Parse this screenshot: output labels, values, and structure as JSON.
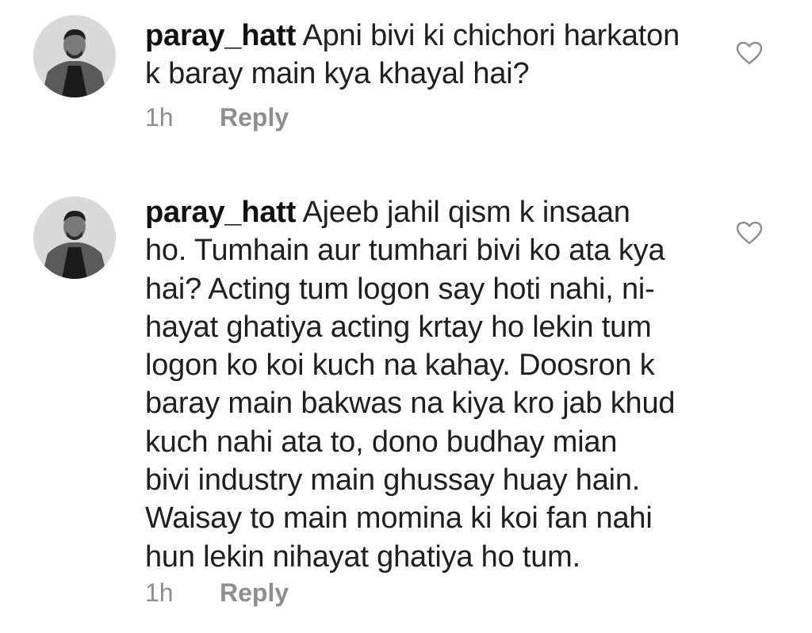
{
  "comments": [
    {
      "username": "paray_hatt",
      "lines": [
        "Apni bivi ki chichori harkaton",
        "k baray main kya khayal hai?"
      ],
      "time": "1h",
      "reply_label": "Reply",
      "icon": "heart-outline-icon"
    },
    {
      "username": "paray_hatt",
      "lines": [
        "Ajeeb jahil qism k insaan",
        "ho. Tumhain aur tumhari bivi ko ata kya",
        "hai? Acting tum logon say hoti nahi, ni-",
        "hayat ghatiya acting krtay ho lekin tum",
        "logon ko koi kuch na kahay. Doosron k",
        "baray main bakwas na kiya kro jab khud",
        "kuch nahi ata to, dono budhay mian",
        "bivi industry main ghussay huay hain.",
        "Waisay to main momina ki koi fan nahi",
        "hun lekin nihayat ghatiya ho tum."
      ],
      "time": "1h",
      "reply_label": "Reply",
      "icon": "heart-outline-icon"
    }
  ],
  "colors": {
    "text": "#1f1f1f",
    "meta": "#8e8e8e",
    "background": "#ffffff"
  }
}
